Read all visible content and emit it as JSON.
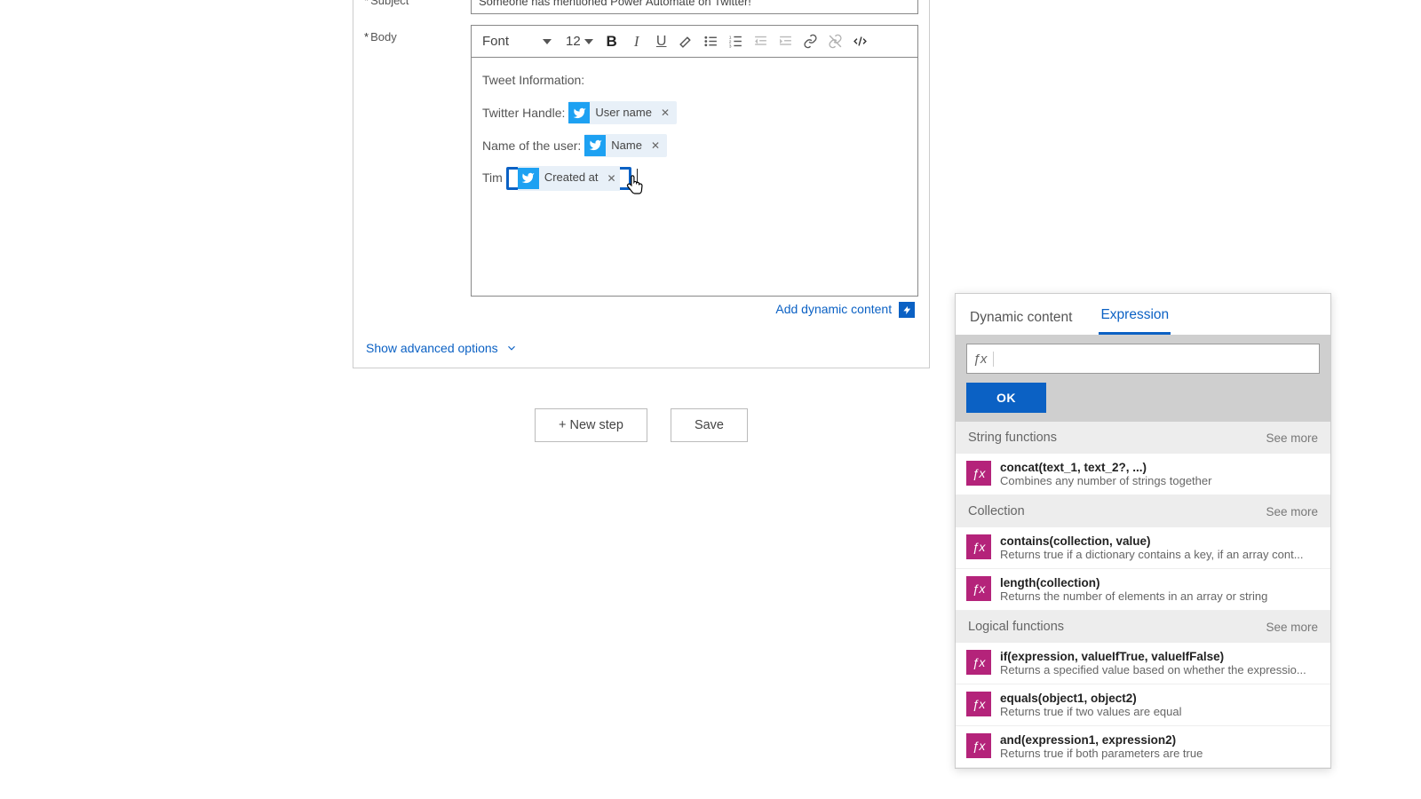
{
  "form": {
    "subject_label": "Subject",
    "subject_value": "Someone has mentioned Power Automate on Twitter!",
    "body_label": "Body",
    "font_label": "Font",
    "font_size": "12",
    "editor": {
      "line1": "Tweet Information:",
      "line2_prefix": "Twitter Handle:",
      "token_username": "User name",
      "line3_prefix": "Name of the user:",
      "token_name": "Name",
      "line4_prefix": "Tim",
      "token_created": "Created at"
    },
    "add_dynamic": "Add dynamic content",
    "show_advanced": "Show advanced options"
  },
  "footer": {
    "new_step": "+ New step",
    "save": "Save"
  },
  "panel": {
    "tab_dynamic": "Dynamic content",
    "tab_expression": "Expression",
    "ok": "OK",
    "groups": [
      {
        "title": "String functions",
        "see": "See more",
        "items": [
          {
            "sig": "concat(text_1, text_2?, ...)",
            "desc": "Combines any number of strings together"
          }
        ]
      },
      {
        "title": "Collection",
        "see": "See more",
        "items": [
          {
            "sig": "contains(collection, value)",
            "desc": "Returns true if a dictionary contains a key, if an array cont..."
          },
          {
            "sig": "length(collection)",
            "desc": "Returns the number of elements in an array or string"
          }
        ]
      },
      {
        "title": "Logical functions",
        "see": "See more",
        "items": [
          {
            "sig": "if(expression, valueIfTrue, valueIfFalse)",
            "desc": "Returns a specified value based on whether the expressio..."
          },
          {
            "sig": "equals(object1, object2)",
            "desc": "Returns true if two values are equal"
          },
          {
            "sig": "and(expression1, expression2)",
            "desc": "Returns true if both parameters are true"
          }
        ]
      }
    ]
  }
}
